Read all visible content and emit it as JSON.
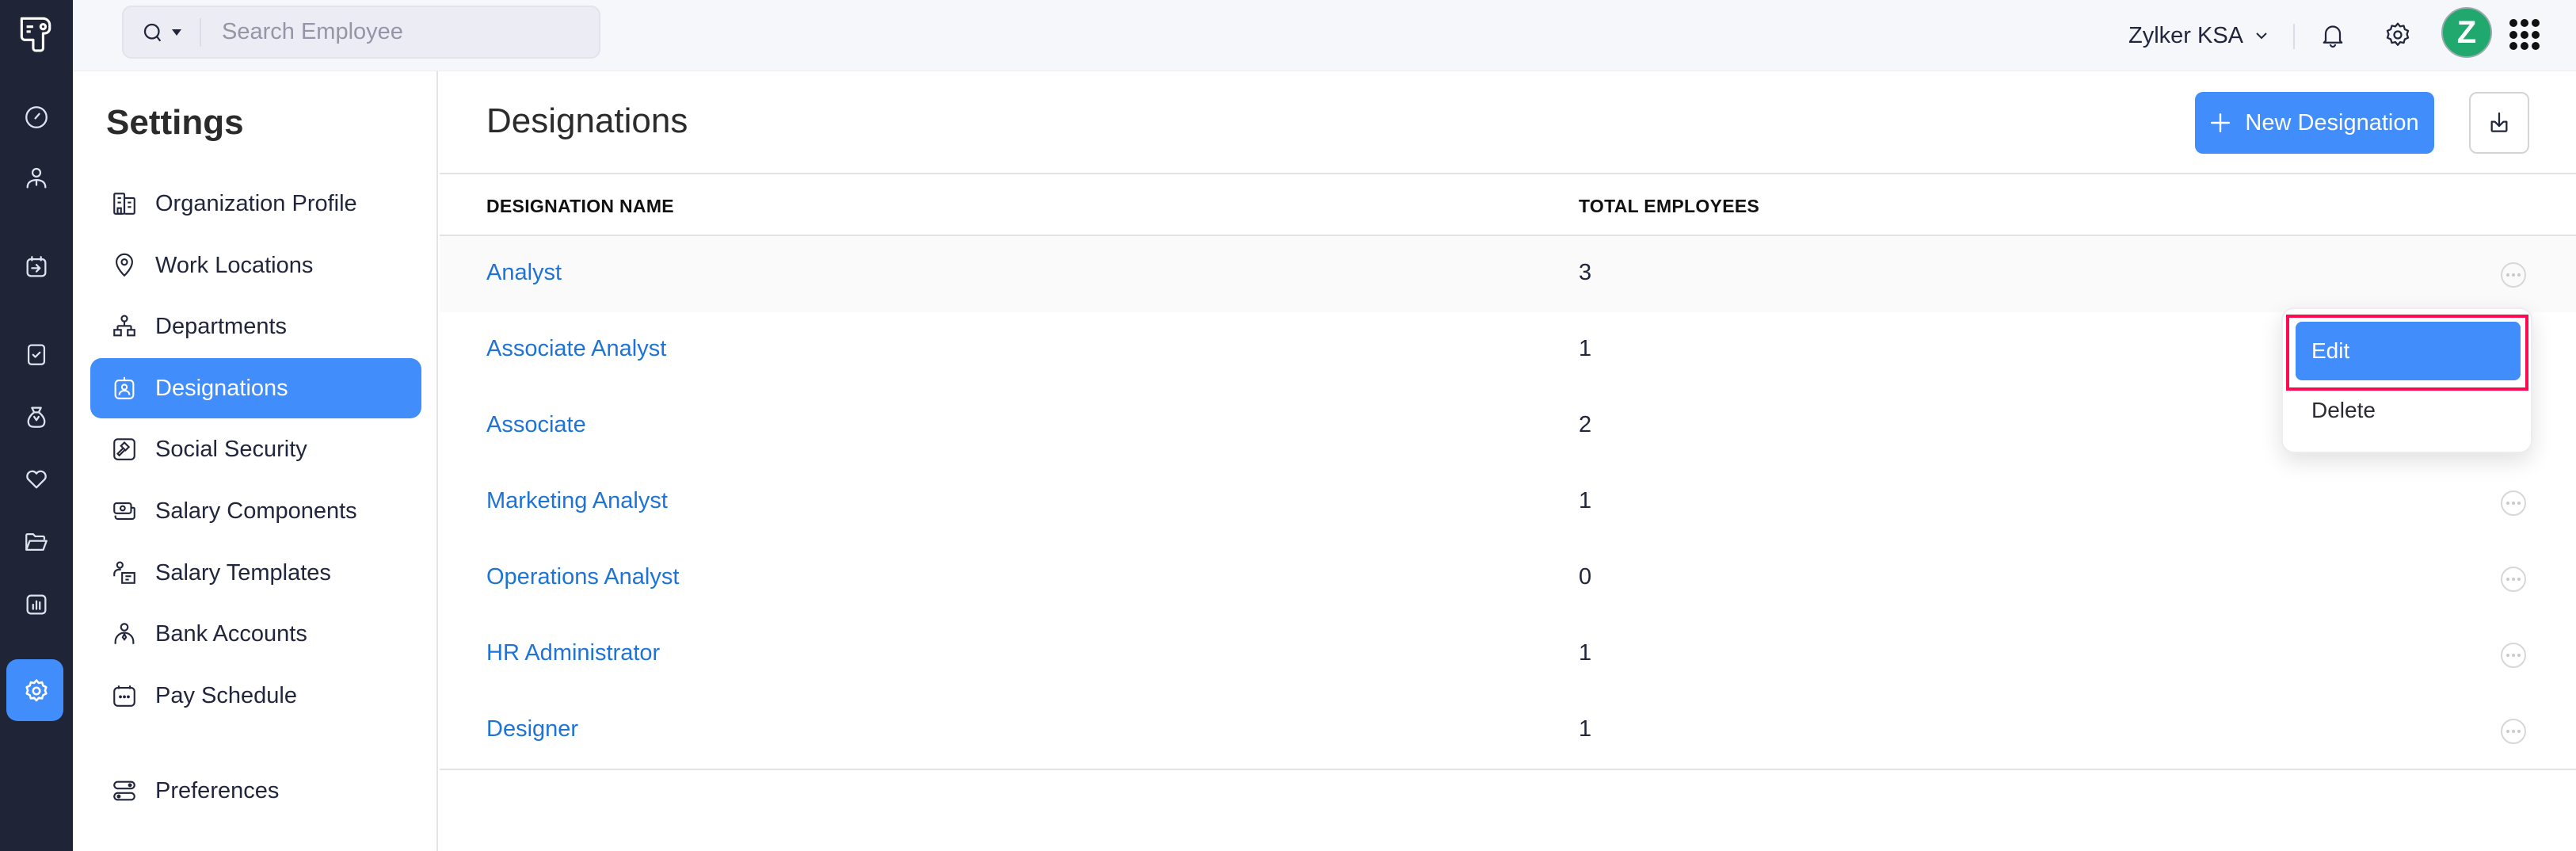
{
  "app": {
    "rail": [
      {
        "name": "dashboard",
        "icon": "gauge-icon"
      },
      {
        "name": "employees",
        "icon": "person-icon"
      },
      {
        "name": "pay-runs",
        "icon": "calendar-arrow-icon"
      },
      {
        "name": "approvals",
        "icon": "clipboard-check-icon"
      },
      {
        "name": "loans",
        "icon": "money-bag-icon"
      },
      {
        "name": "benefits",
        "icon": "heart-icon"
      },
      {
        "name": "documents",
        "icon": "folder-open-icon"
      },
      {
        "name": "reports",
        "icon": "bar-chart-icon"
      },
      {
        "name": "settings",
        "icon": "gear-icon",
        "active": true
      }
    ],
    "accent_color": "#408dfb"
  },
  "topbar": {
    "search": {
      "placeholder": "Search Employee",
      "value": ""
    },
    "organization": "Zylker KSA",
    "avatar_initial": "Z"
  },
  "settings": {
    "title": "Settings",
    "items": [
      {
        "label": "Organization Profile",
        "icon": "building-icon"
      },
      {
        "label": "Work Locations",
        "icon": "map-pin-icon"
      },
      {
        "label": "Departments",
        "icon": "org-chart-icon"
      },
      {
        "label": "Designations",
        "icon": "id-badge-icon",
        "active": true
      },
      {
        "label": "Social Security",
        "icon": "gavel-icon"
      },
      {
        "label": "Salary Components",
        "icon": "cash-icon"
      },
      {
        "label": "Salary Templates",
        "icon": "person-card-icon"
      },
      {
        "label": "Bank Accounts",
        "icon": "person-tie-icon"
      },
      {
        "label": "Pay Schedule",
        "icon": "calendar-dots-icon"
      },
      {
        "label": "Preferences",
        "icon": "toggles-icon"
      }
    ]
  },
  "main": {
    "title": "Designations",
    "new_button": "New Designation",
    "columns": [
      "DESIGNATION NAME",
      "TOTAL EMPLOYEES"
    ],
    "rows": [
      {
        "name": "Analyst",
        "count": "3"
      },
      {
        "name": "Associate Analyst",
        "count": "1"
      },
      {
        "name": "Associate",
        "count": "2"
      },
      {
        "name": "Marketing Analyst",
        "count": "1"
      },
      {
        "name": "Operations Analyst",
        "count": "0"
      },
      {
        "name": "HR Administrator",
        "count": "1"
      },
      {
        "name": "Designer",
        "count": "1"
      }
    ],
    "row_menu": {
      "items": [
        "Edit",
        "Delete"
      ],
      "active_item": "Edit",
      "highlight_color": "#ff0a4f"
    }
  }
}
